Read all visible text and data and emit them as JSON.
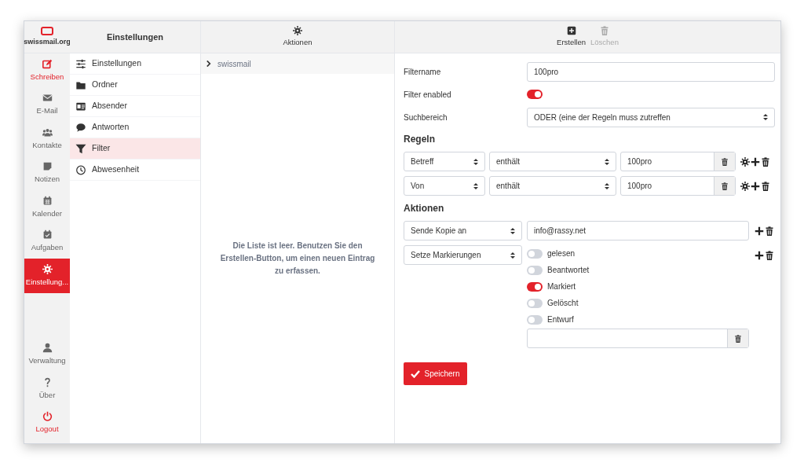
{
  "brand": "swissmail.org",
  "nav_top": [
    {
      "label": "Schreiben",
      "accent": true,
      "selected": false
    },
    {
      "label": "E-Mail",
      "accent": false,
      "selected": false
    },
    {
      "label": "Kontakte",
      "accent": false,
      "selected": false
    },
    {
      "label": "Notizen",
      "accent": false,
      "selected": false
    },
    {
      "label": "Kalender",
      "accent": false,
      "selected": false
    },
    {
      "label": "Aufgaben",
      "accent": false,
      "selected": false
    },
    {
      "label": "Einstellung...",
      "selected": true
    }
  ],
  "nav_bottom": [
    {
      "label": "Verwaltung",
      "accent": false
    },
    {
      "label": "Über",
      "accent": false
    },
    {
      "label": "Logout",
      "accent": true
    }
  ],
  "settings": {
    "title": "Einstellungen",
    "items": [
      {
        "label": "Einstellungen",
        "selected": false
      },
      {
        "label": "Ordner",
        "selected": false
      },
      {
        "label": "Absender",
        "selected": false
      },
      {
        "label": "Antworten",
        "selected": false
      },
      {
        "label": "Filter",
        "selected": true
      },
      {
        "label": "Abwesenheit",
        "selected": false
      }
    ]
  },
  "list": {
    "toolbar": [
      {
        "label": "Aktionen"
      }
    ],
    "tree": [
      {
        "label": "swissmail",
        "expanded": false
      }
    ],
    "empty_message": "Die Liste ist leer. Benutzen Sie den Erstellen-Button, um einen neuen Eintrag zu erfassen."
  },
  "editor": {
    "toolbar": [
      {
        "label": "Erstellen",
        "disabled": false
      },
      {
        "label": "Löschen",
        "disabled": true
      }
    ],
    "fields": [
      {
        "kind": "text",
        "label": "Filtername",
        "value": "100pro"
      },
      {
        "kind": "toggle",
        "label": "Filter enabled",
        "on": true
      },
      {
        "kind": "select",
        "label": "Suchbereich",
        "value": "ODER (eine der Regeln muss zutreffen"
      }
    ],
    "rules_heading": "Regeln",
    "rules": [
      {
        "field": "Betreff",
        "operator": "enthält",
        "value": "100pro"
      },
      {
        "field": "Von",
        "operator": "enthält",
        "value": "100pro"
      }
    ],
    "actions_heading": "Aktionen",
    "actions": [
      {
        "kind": "text",
        "type": "Sende Kopie an",
        "value": "info@rassy.net"
      },
      {
        "kind": "flags",
        "type": "Setze Markierungen",
        "flags": [
          {
            "label": "gelesen",
            "on": false
          },
          {
            "label": "Beantwortet",
            "on": false
          },
          {
            "label": "Markiert",
            "on": true
          },
          {
            "label": "Gelöscht",
            "on": false
          },
          {
            "label": "Entwurf",
            "on": false
          }
        ]
      }
    ],
    "save_button": "Speichern"
  }
}
